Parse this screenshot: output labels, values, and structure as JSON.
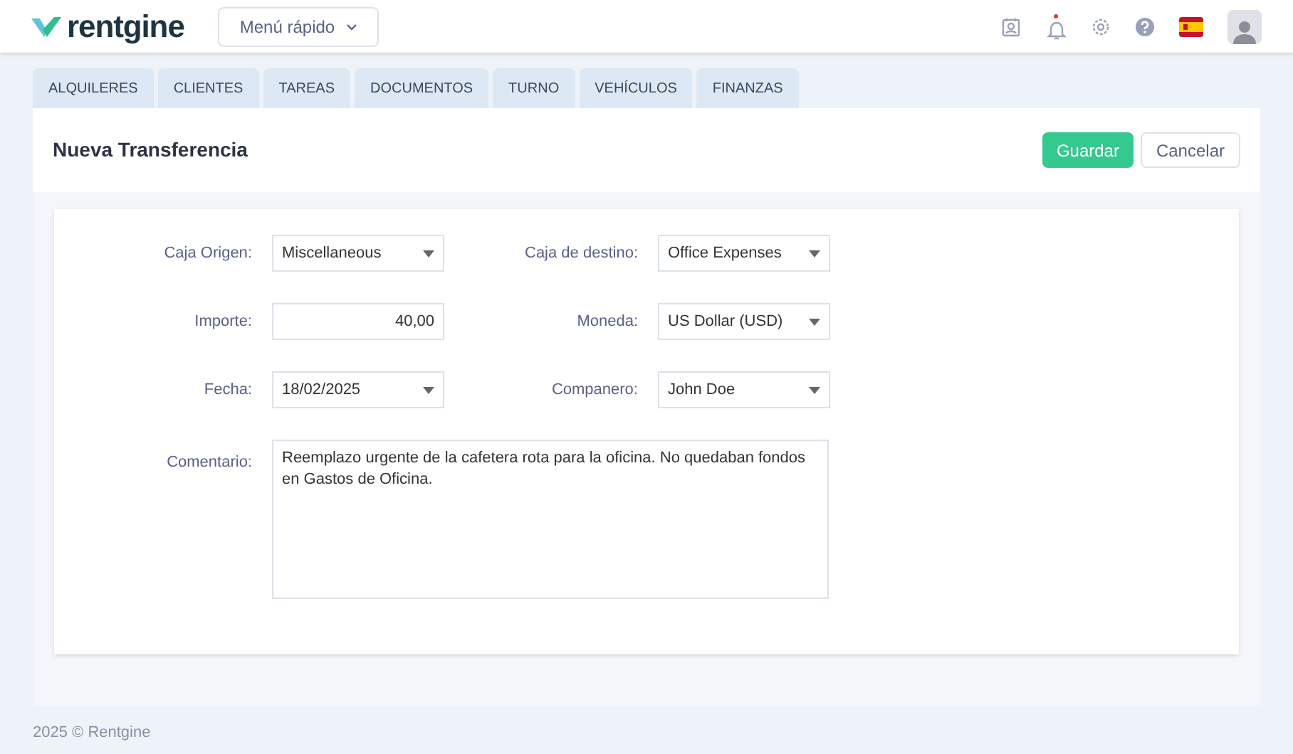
{
  "header": {
    "brand": "rentgine",
    "quick_menu": "Menú rápido",
    "notification": true
  },
  "tabs": [
    {
      "label": "ALQUILERES",
      "selected": false
    },
    {
      "label": "CLIENTES",
      "selected": false
    },
    {
      "label": "TAREAS",
      "selected": false
    },
    {
      "label": "DOCUMENTOS",
      "selected": false
    },
    {
      "label": "TURNO",
      "selected": false
    },
    {
      "label": "VEHÍCULOS",
      "selected": false
    },
    {
      "label": "FINANZAS",
      "selected": false
    }
  ],
  "page": {
    "title": "Nueva Transferencia",
    "buttons": [
      {
        "label": "Guardar",
        "kind": "primary"
      },
      {
        "label": "Cancelar",
        "kind": "secondary"
      }
    ]
  },
  "form": {
    "rows": [
      [
        {
          "label": "Caja Origen:",
          "kind": "select",
          "value": "Miscellaneous"
        },
        {
          "label": "Caja de destino:",
          "kind": "select",
          "value": "Office Expenses"
        }
      ],
      [
        {
          "label": "Importe:",
          "kind": "number",
          "value": "40,00"
        },
        {
          "label": "Moneda:",
          "kind": "select",
          "value": "US Dollar (USD)"
        }
      ],
      [
        {
          "label": "Fecha:",
          "kind": "select",
          "value": "18/02/2025"
        },
        {
          "label": "Companero:",
          "kind": "select",
          "value": "John Doe"
        }
      ]
    ],
    "comment": {
      "label": "Comentario:",
      "value": "Reemplazo urgente de la cafetera rota para la oficina. No quedaban fondos en Gastos de Oficina."
    }
  },
  "footer": "2025 © Rentgine"
}
